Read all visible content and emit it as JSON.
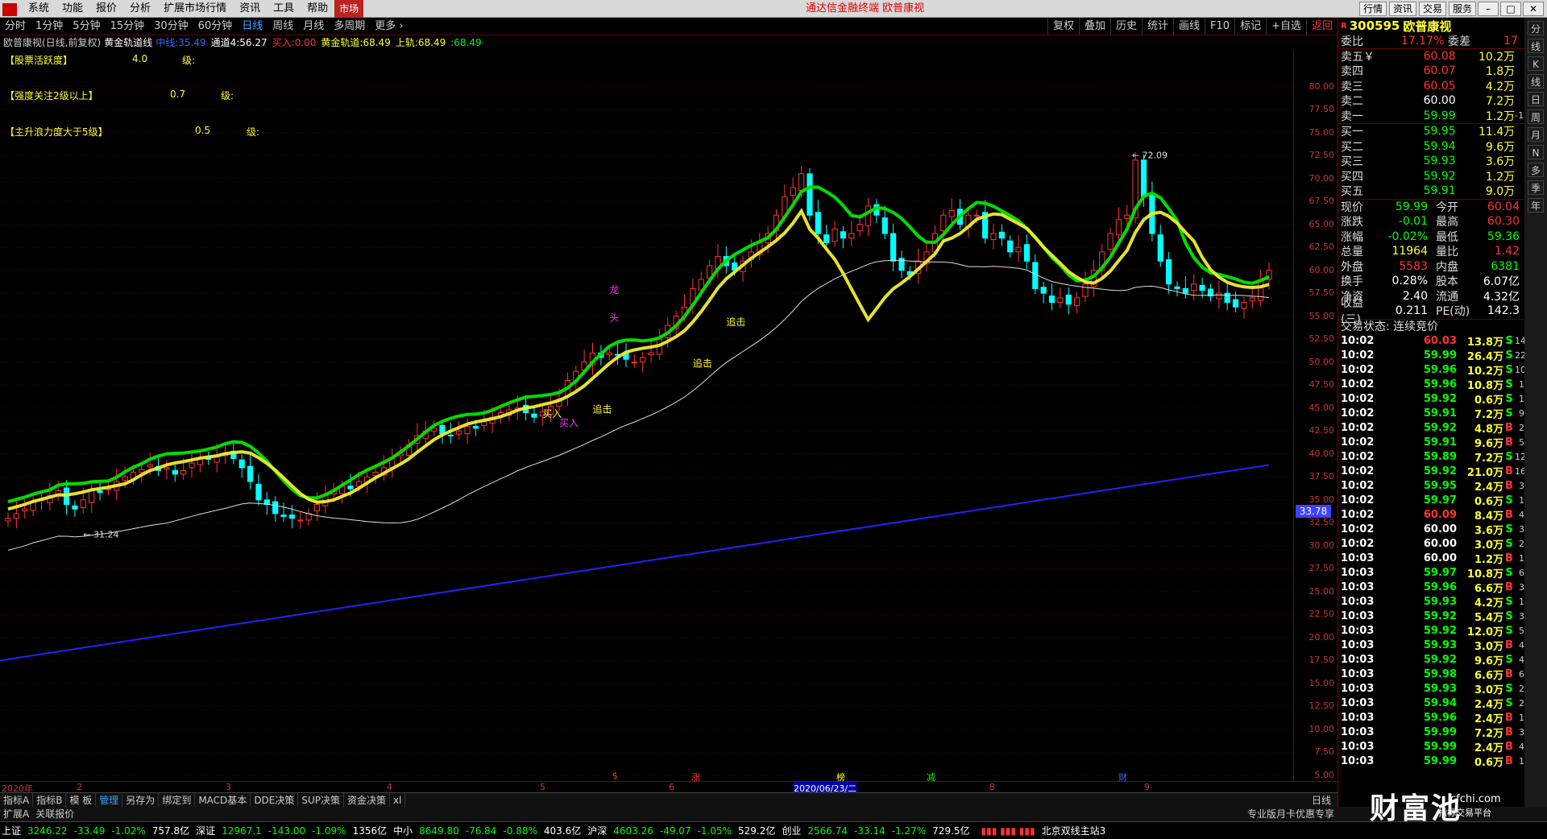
{
  "menu": {
    "items": [
      "系统",
      "功能",
      "报价",
      "分析",
      "扩展市场行情",
      "资讯",
      "工具",
      "帮助"
    ],
    "market": "市场",
    "title": "通达信金融终端  欧普康视",
    "right": [
      "行情",
      "资讯",
      "交易",
      "服务"
    ]
  },
  "toolbar": {
    "periods": [
      "分时",
      "1分钟",
      "5分钟",
      "15分钟",
      "30分钟",
      "60分钟",
      "日线",
      "周线",
      "月线",
      "多周期",
      "更多 ›"
    ],
    "active": "日线",
    "right": [
      "复权",
      "叠加",
      "历史",
      "统计",
      "画线",
      "F10",
      "标记",
      "+自选",
      "返回"
    ]
  },
  "info": {
    "name": "欧普康视(日线,前复权)",
    "indicator": "黄金轨道线",
    "ind_label": "中线:",
    "ind_val": "35.49",
    "ch4_label": "通道4:",
    "ch4_val": "56.27",
    "buy_label": "买入:",
    "buy_val": "0.00",
    "gold_label": "黄金轨道:",
    "gold_val": "68.49",
    "upper_label": "上轨:",
    "upper_val": "68.49",
    "extra": ":68.49"
  },
  "notes": [
    {
      "label": "【股票活跃度】",
      "val": "4.0",
      "unit": "级:"
    },
    {
      "label": "【强度关注2级以上】",
      "val": "0.7",
      "unit": "级:"
    },
    {
      "label": "【主升浪力度大于5级】",
      "val": "0.5",
      "unit": "级:"
    }
  ],
  "chart_data": {
    "type": "candlestick",
    "ylim": [
      5,
      82.5
    ],
    "yticks": [
      "80.00",
      "77.50",
      "75.00",
      "72.50",
      "70.00",
      "67.50",
      "65.00",
      "62.50",
      "60.00",
      "57.50",
      "55.00",
      "52.50",
      "50.00",
      "47.50",
      "45.00",
      "42.50",
      "40.00",
      "37.50",
      "35.00",
      "32.50",
      "30.00",
      "27.50",
      "25.00",
      "22.50",
      "20.00",
      "17.50",
      "15.00",
      "12.50",
      "10.00",
      "7.50",
      "5.00"
    ],
    "high_label": "72.09",
    "low_label": "31.24",
    "current": "33.78",
    "annotations": [
      "龙",
      "头",
      "追击",
      "追击",
      "追击",
      "买入",
      "买入"
    ],
    "xlabels": [
      "2020年",
      "2",
      "3",
      "4",
      "5",
      "6",
      "2020/06/23/二",
      "8",
      "9"
    ],
    "event_marks": [
      "$",
      "涨",
      "榜",
      "减",
      "财"
    ],
    "closes": [
      33,
      33.5,
      34,
      34.8,
      35,
      35.5,
      36,
      34.5,
      34,
      35,
      36,
      35.8,
      36.2,
      37,
      37.5,
      38,
      38.3,
      38.8,
      38.2,
      38.5,
      37.8,
      38.2,
      39,
      39.5,
      39.4,
      39.8,
      40,
      39.5,
      38.5,
      37,
      35,
      34.5,
      33.5,
      33.2,
      33,
      32.8,
      33.5,
      34.5,
      35.5,
      36,
      36.5,
      36.2,
      37,
      37.5,
      38,
      38.5,
      39.5,
      40,
      41,
      42,
      42.5,
      42.8,
      42.2,
      42,
      42.5,
      43,
      42.8,
      43.5,
      44,
      44.5,
      44.8,
      45,
      44.5,
      44,
      44.6,
      45.2,
      46,
      48,
      49,
      50,
      51,
      50.5,
      51,
      50.8,
      50.3,
      50,
      50.5,
      51,
      52.5,
      54,
      55,
      56,
      58,
      59,
      60.5,
      61.5,
      60.5,
      60,
      61,
      62,
      63,
      64,
      66,
      68,
      69,
      70.5,
      66,
      64,
      63,
      64.5,
      63.5,
      64,
      65,
      67,
      66,
      64,
      61,
      60,
      59.5,
      61,
      62,
      64,
      66,
      66.5,
      65,
      66,
      66,
      63.5,
      64,
      63.5,
      62,
      62.5,
      61,
      58,
      57.5,
      56.5,
      57,
      56.3,
      57,
      58.5,
      60,
      62,
      64,
      65.5,
      66,
      72,
      68,
      64,
      61,
      58.5,
      58,
      57.5,
      58.5,
      57.8,
      57.2,
      57.5,
      56.5,
      56,
      56.5,
      57,
      59,
      60
    ]
  },
  "panel": {
    "code": "300595",
    "name": "欧普康视",
    "wb_label": "委比",
    "wb": "17.17%",
    "wc_label": "委差",
    "wc": "17",
    "sells": [
      [
        "卖五￥",
        "60.08",
        "10.2万"
      ],
      [
        "卖四",
        "60.07",
        "1.8万"
      ],
      [
        "卖三",
        "60.05",
        "4.2万"
      ],
      [
        "卖二",
        "60.00",
        "7.2万"
      ],
      [
        "卖一",
        "59.99",
        "1.2万",
        "-1"
      ]
    ],
    "buys": [
      [
        "买一",
        "59.95",
        "11.4万"
      ],
      [
        "买二",
        "59.94",
        "9.6万"
      ],
      [
        "买三",
        "59.93",
        "3.6万"
      ],
      [
        "买四",
        "59.92",
        "1.2万"
      ],
      [
        "买五",
        "59.91",
        "9.0万"
      ]
    ],
    "stats": [
      [
        "现价",
        "59.99",
        "今开",
        "60.04"
      ],
      [
        "涨跌",
        "-0.01",
        "最高",
        "60.30"
      ],
      [
        "涨幅",
        "-0.02%",
        "最低",
        "59.36"
      ],
      [
        "总量",
        "11964",
        "量比",
        "1.42"
      ],
      [
        "外盘",
        "5583",
        "内盘",
        "6381"
      ],
      [
        "换手",
        "0.28%",
        "股本",
        "6.07亿"
      ],
      [
        "净资",
        "2.40",
        "流通",
        "4.32亿"
      ],
      [
        "收益(三)",
        "0.211",
        "PE(动)",
        "142.3"
      ]
    ],
    "trade_state": "交易状态: 连续竞价",
    "ticks": [
      [
        "10:02",
        "60.03",
        "13.8万",
        "S",
        "14"
      ],
      [
        "10:02",
        "59.99",
        "26.4万",
        "S",
        "22"
      ],
      [
        "10:02",
        "59.96",
        "10.2万",
        "S",
        "10"
      ],
      [
        "10:02",
        "59.96",
        "10.8万",
        "S",
        "1"
      ],
      [
        "10:02",
        "59.92",
        "0.6万",
        "S",
        "1"
      ],
      [
        "10:02",
        "59.91",
        "7.2万",
        "S",
        "9"
      ],
      [
        "10:02",
        "59.92",
        "4.8万",
        "B",
        "2"
      ],
      [
        "10:02",
        "59.91",
        "9.6万",
        "B",
        "5"
      ],
      [
        "10:02",
        "59.89",
        "7.2万",
        "S",
        "12"
      ],
      [
        "10:02",
        "59.92",
        "21.0万",
        "B",
        "16"
      ],
      [
        "10:02",
        "59.95",
        "2.4万",
        "B",
        "3"
      ],
      [
        "10:02",
        "59.97",
        "0.6万",
        "S",
        "1"
      ],
      [
        "10:02",
        "60.09",
        "8.4万",
        "B",
        "4"
      ],
      [
        "10:02",
        "60.00",
        "3.6万",
        "S",
        "3"
      ],
      [
        "10:02",
        "60.00",
        "3.0万",
        "S",
        "2"
      ],
      [
        "10:03",
        "60.00",
        "1.2万",
        "B",
        "1"
      ],
      [
        "10:03",
        "59.97",
        "10.8万",
        "S",
        "6"
      ],
      [
        "10:03",
        "59.96",
        "6.6万",
        "B",
        "3"
      ],
      [
        "10:03",
        "59.93",
        "4.2万",
        "S",
        "1"
      ],
      [
        "10:03",
        "59.92",
        "5.4万",
        "S",
        "3"
      ],
      [
        "10:03",
        "59.92",
        "12.0万",
        "S",
        "5"
      ],
      [
        "10:03",
        "59.93",
        "3.0万",
        "B",
        "4"
      ],
      [
        "10:03",
        "59.92",
        "9.6万",
        "S",
        "4"
      ],
      [
        "10:03",
        "59.98",
        "6.6万",
        "B",
        "6"
      ],
      [
        "10:03",
        "59.93",
        "3.0万",
        "S",
        "2"
      ],
      [
        "10:03",
        "59.94",
        "2.4万",
        "S",
        "2"
      ],
      [
        "10:03",
        "59.96",
        "2.4万",
        "B",
        "1"
      ],
      [
        "10:03",
        "59.99",
        "7.2万",
        "B",
        "3"
      ],
      [
        "10:03",
        "59.99",
        "2.4万",
        "B",
        "4"
      ],
      [
        "10:03",
        "59.99",
        "0.6万",
        "B",
        "1"
      ]
    ]
  },
  "bottom_tabs": [
    "指标A",
    "指标B",
    "模 板",
    "管理",
    "另存为",
    "绑定到",
    "MACD基本",
    "DDE决策",
    "SUP决策",
    "资金决策",
    "xl"
  ],
  "bottom_active": "管理",
  "bottom2": [
    "扩展A",
    "关联报价"
  ],
  "promo": "专业版月卡优惠专享",
  "period_label": "日线",
  "status": [
    [
      "上证",
      "3246.22",
      "-33.49",
      "-1.02%",
      "757.8亿"
    ],
    [
      "深证",
      "12967.1",
      "-143.00",
      "-1.09%",
      "1356亿"
    ],
    [
      "中小",
      "8649.80",
      "-76.84",
      "-0.88%",
      "403.6亿"
    ],
    [
      "沪深",
      "4603.26",
      "-49.07",
      "-1.05%",
      "529.2亿"
    ],
    [
      "创业",
      "2566.74",
      "-33.14",
      "-1.27%",
      "729.5亿"
    ]
  ],
  "server": "北京双线主站3",
  "watermark": {
    "brand": "财富池",
    "site": "cfchi.com",
    "sub": "指标交易平台"
  },
  "sidebar": [
    "分",
    "线",
    "K",
    "线",
    "日",
    "周",
    "月",
    "N",
    "多",
    "季",
    "年"
  ]
}
